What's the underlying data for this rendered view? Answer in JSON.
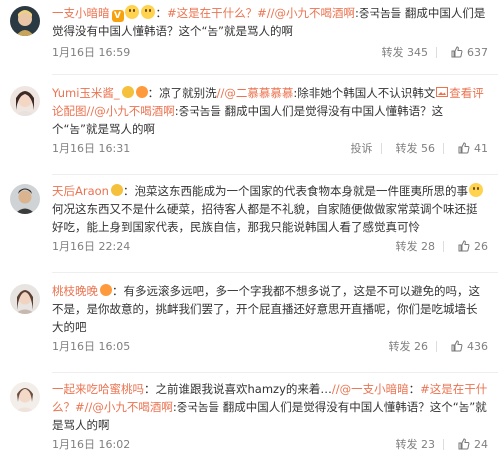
{
  "comments": [
    {
      "user": "一支小暗暗",
      "topic": "#这是在干什么？#",
      "sep1": "：",
      "mention": "//@小九不喝酒啊",
      "text": ":중국놈들 翻成中国人们是觉得没有中国人懂韩语？这个“놈”就是骂人的啊",
      "time": "1月16日 16:59",
      "repost_label": "转发 345",
      "likes": "637",
      "has_reply": false
    },
    {
      "user": "Yumi玉米酱_",
      "text_a": "：凉了就别洗",
      "mention1": "//@二慕慕慕慕",
      "text_b": ":除非她个韩国人不认识韩文",
      "link": "查看评论配图",
      "mention2": "//@小九不喝酒啊",
      "text_c": ":중국놈들 翻成中国人们是觉得没有中国人懂韩语？这个“놈”就是骂人的啊",
      "time": "1月16日 16:31",
      "report_label": "投诉",
      "repost_label": "转发 56",
      "likes": "41"
    },
    {
      "user": "天后Araon",
      "text_a": "：泡菜这东西能成为一个国家的代表食物本身就是一件匪夷所思的事",
      "text_b": "何况这东西又不是什么硬菜，招待客人都是不礼貌，自家随便做做家常菜调个味还挺好吃，能上身到国家代表，民族自信，那我只能说韩国人看了感觉真可怜",
      "time": "1月16日 22:24",
      "repost_label": "转发 28",
      "likes": "26"
    },
    {
      "user": "桃枝晚晚",
      "text": "：有多远滚多远吧，多一个字我都不想多说了，这是不可以避免的吗，这不是，是你故意的，挑衅我们罢了，开个屁直播还好意思开直播呢，你们是吃城墙长大的吧",
      "time": "1月16日 16:05",
      "repost_label": "转发 26",
      "likes": "436"
    },
    {
      "user": "一起来吃哈蜜桃吗",
      "text_a": "：之前谁跟我说喜欢hamzy的来着…",
      "mention1": "//@一支小暗暗",
      "sep": "：",
      "topic": "#这是在干什么？#",
      "mention2": "//@小九不喝酒啊",
      "text_b": ":중국놈들 翻成中国人们是觉得没有中国人懂韩语？这个“놈”就是骂人的啊",
      "time": "1月16日 16:02",
      "repost_label": "转发 23",
      "likes": "24"
    }
  ],
  "colors": {
    "accent": "#eb7350",
    "meta": "#808080",
    "badge_v": "#f7a10e"
  }
}
